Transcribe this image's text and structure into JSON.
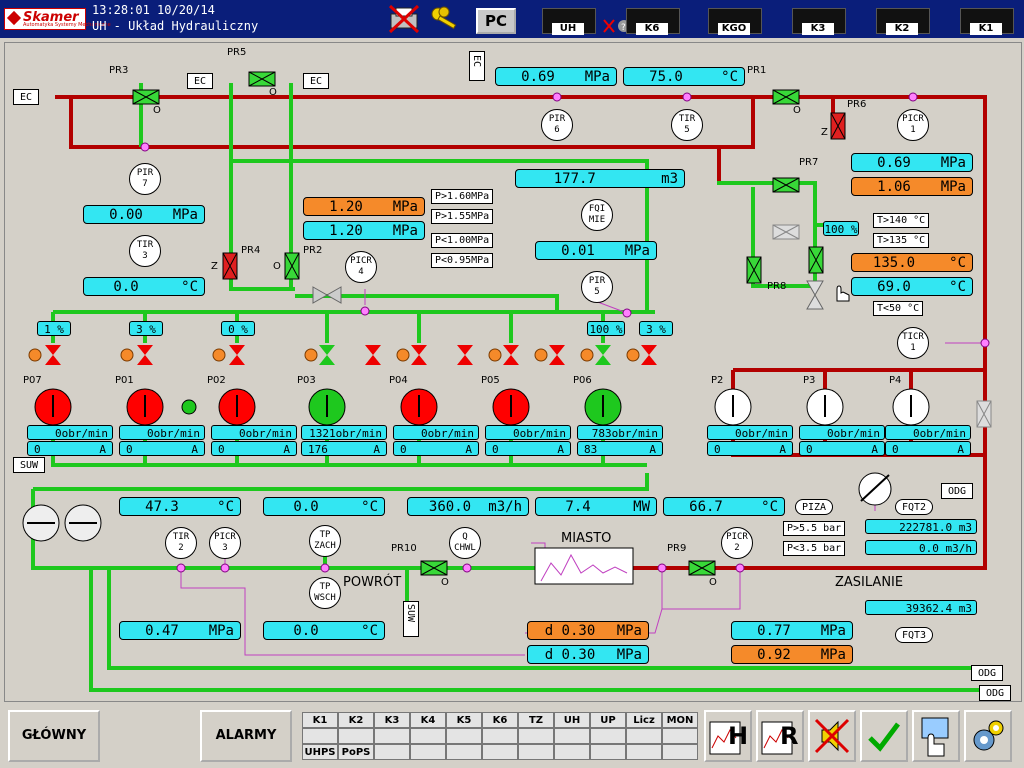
{
  "header": {
    "time": "13:28:01",
    "date": "10/20/14",
    "title": "UH - Układ Hydrauliczny",
    "logo": "Skamer",
    "logo_sub": "Automatyka Systemy Mechaniczne",
    "pc_button": "PC",
    "units": [
      "UH",
      "K6",
      "KGO",
      "K3",
      "K2",
      "K1"
    ]
  },
  "tags": {
    "ec": "EC",
    "suw": "SUW",
    "odg": "ODG",
    "powrot": "POWRÓT",
    "zasilanie": "ZASILANIE",
    "miasto": "MIASTO"
  },
  "valve_labels": {
    "PR3": "PR3",
    "PR5": "PR5",
    "PR1": "PR1",
    "PR6": "PR6",
    "PR7": "PR7",
    "PR8": "PR8",
    "PR4": "PR4",
    "PR2": "PR2",
    "PR10": "PR10",
    "PR9": "PR9",
    "o": "O",
    "z": "Z"
  },
  "measurements": {
    "pir6": "0.69",
    "pir6_unit": "MPa",
    "tir5": "75.0",
    "tir5_unit": "°C",
    "picr1_a": "0.69",
    "picr1_a_unit": "MPa",
    "picr1_b": "1.06",
    "picr1_b_unit": "MPa",
    "pir7": "0.00",
    "pir7_unit": "MPa",
    "tir3": "0.0",
    "tir3_unit": "°C",
    "picr4_a": "1.20",
    "picr4_a_unit": "MPa",
    "picr4_b": "1.20",
    "picr4_b_unit": "MPa",
    "fqi_mie": "177.7",
    "fqi_mie_unit": "m3",
    "fqi_flow": "0.01",
    "fqi_flow_unit": "MPa",
    "ticr1_a": "135.0",
    "ticr1_a_unit": "°C",
    "ticr1_b": "69.0",
    "ticr1_b_unit": "°C",
    "tir2": "47.3",
    "tir2_unit": "°C",
    "tp_zach": "0.0",
    "tp_zach_unit": "°C",
    "qchwl": "360.0",
    "qchwl_unit": "m3/h",
    "power": "7.4",
    "power_unit": "MW",
    "t_zas": "66.7",
    "t_zas_unit": "°C",
    "picr3": "0.47",
    "picr3_unit": "MPa",
    "tp_wsch": "0.0",
    "tp_wsch_unit": "°C",
    "d1": "d  0.30",
    "d1_unit": "MPa",
    "d2": "d  0.30",
    "d2_unit": "MPa",
    "picr2_a": "0.77",
    "picr2_a_unit": "MPa",
    "picr2_b": "0.92",
    "picr2_b_unit": "MPa",
    "fqt2_a": "222781.0",
    "fqt2_a_unit": "m3",
    "fqt2_b": "0.0",
    "fqt2_b_unit": "m3/h",
    "fqt3": "39362.4",
    "fqt3_unit": "m3"
  },
  "limits": {
    "p160": "P>1.60MPa",
    "p155": "P>1.55MPa",
    "p100": "P<1.00MPa",
    "p095": "P<0.95MPa",
    "t140": "T>140 °C",
    "t135": "T>135 °C",
    "t50": "T<50 °C",
    "p55": "P>5.5 bar",
    "p35": "P<3.5 bar"
  },
  "instruments": {
    "pir6": [
      "PIR",
      "6"
    ],
    "tir5": [
      "TIR",
      "5"
    ],
    "picr1": [
      "PICR",
      "1"
    ],
    "pir7": [
      "PIR",
      "7"
    ],
    "tir3": [
      "TIR",
      "3"
    ],
    "picr4": [
      "PICR",
      "4"
    ],
    "fqi": [
      "FQI",
      "MIE"
    ],
    "pir5": [
      "PIR",
      "5"
    ],
    "ticr1": [
      "TICR",
      "1"
    ],
    "tir2": [
      "TIR",
      "2"
    ],
    "picr3": [
      "PICR",
      "3"
    ],
    "tpzach": [
      "TP",
      "ZACH"
    ],
    "tpwsch": [
      "TP",
      "WSCH"
    ],
    "qchwl": [
      "Q",
      "CHWL"
    ],
    "picr2": [
      "PICR",
      "2"
    ],
    "piza": "PIZA",
    "fqt2": "FQT2",
    "fqt3": "FQT3"
  },
  "valve_pct": {
    "v1": "1 %",
    "v2": "3 %",
    "v3": "0 %",
    "v4": "100 %",
    "v5": "3 %",
    "v6": "100 %"
  },
  "pumps": [
    {
      "name": "P07",
      "speed": "0obr/min",
      "current": "0",
      "unit": "A",
      "state": "off"
    },
    {
      "name": "P01",
      "speed": "0obr/min",
      "current": "0",
      "unit": "A",
      "state": "off"
    },
    {
      "name": "P02",
      "speed": "0obr/min",
      "current": "0",
      "unit": "A",
      "state": "off"
    },
    {
      "name": "P03",
      "speed": "1321obr/min",
      "current": "176",
      "unit": "A",
      "state": "on"
    },
    {
      "name": "P04",
      "speed": "0obr/min",
      "current": "0",
      "unit": "A",
      "state": "off"
    },
    {
      "name": "P05",
      "speed": "0obr/min",
      "current": "0",
      "unit": "A",
      "state": "off"
    },
    {
      "name": "P06",
      "speed": "783obr/min",
      "current": "83",
      "unit": "A",
      "state": "on"
    },
    {
      "name": "P2",
      "speed": "0obr/min",
      "current": "0",
      "unit": "A",
      "state": "idle"
    },
    {
      "name": "P3",
      "speed": "0obr/min",
      "current": "0",
      "unit": "A",
      "state": "idle"
    },
    {
      "name": "P4",
      "speed": "0obr/min",
      "current": "0",
      "unit": "A",
      "state": "idle"
    }
  ],
  "footer": {
    "main": "GŁÓWNY",
    "alarms": "ALARMY",
    "grid_row1": [
      "K1",
      "K2",
      "K3",
      "K4",
      "K5",
      "K6",
      "TZ",
      "UH",
      "UP",
      "Licz",
      "MON"
    ],
    "grid_row3": [
      "UHPS",
      "PoPS"
    ],
    "h_label": "H",
    "r_label": "R"
  },
  "colors": {
    "pipe_red": "#b20000",
    "pipe_green": "#1ec81e",
    "pump_on": "#1ec81e",
    "pump_off": "#ff0000",
    "cyan": "#33e6f2",
    "orange": "#f58a2a",
    "header_bg": "#0a1e7a"
  }
}
